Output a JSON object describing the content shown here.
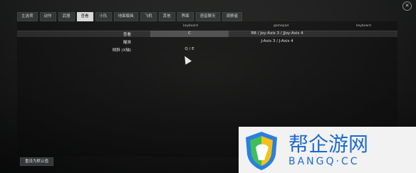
{
  "tabs": [
    "主选项",
    "动作",
    "武器",
    "查看",
    "小队",
    "地面载具",
    "飞机",
    "其他",
    "界面",
    "语音聊天",
    "观察者"
  ],
  "active_tab_index": 3,
  "columns": {
    "col1": "keyboard",
    "col2": "gamepad",
    "col3": "keyboard"
  },
  "rows": [
    {
      "label": "查看",
      "binding1": "C",
      "binding2": "RB / Joy-Axis 3 / JJoy-Axis 4",
      "selected": true
    },
    {
      "label": "瞄准",
      "binding1": "",
      "binding2": "J-Axis 3 / J-Axis 4",
      "selected": false
    },
    {
      "label": "倾斜 (X轴)",
      "binding1": "Q / E",
      "binding2": "",
      "selected": false
    }
  ],
  "reset_button": "重设为默认值",
  "watermark": {
    "title": "帮企游网",
    "subtitle": "BANGQ·CC"
  },
  "colors": {
    "accent_tab": "#d9d9d9",
    "watermark": "#1d6bd0"
  }
}
